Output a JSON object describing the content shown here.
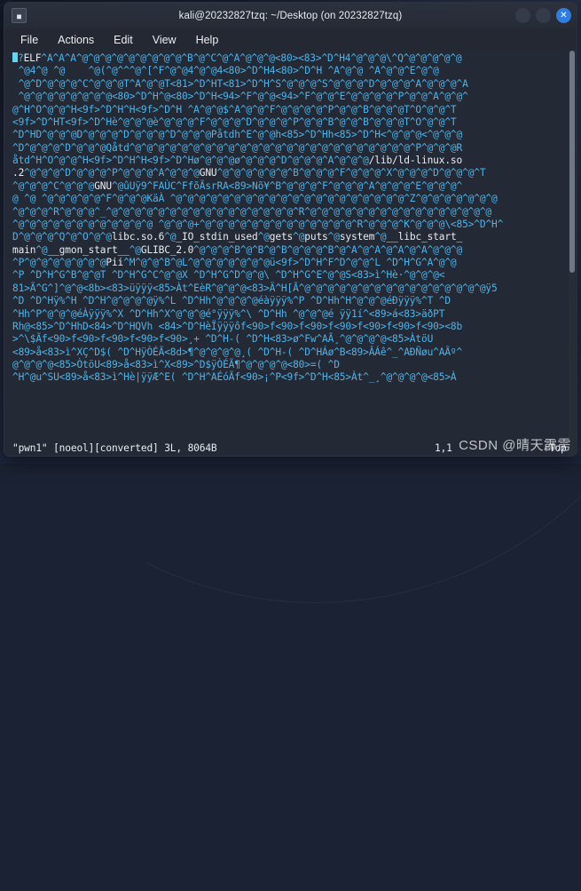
{
  "window": {
    "title": "kali@20232827tzq: ~/Desktop (on 20232827tzq)",
    "app_icon": "terminal-icon",
    "icon_glyph": "■",
    "buttons": {
      "minimize": "",
      "maximize": "",
      "close": "✕"
    }
  },
  "menubar": {
    "items": [
      {
        "label": "File"
      },
      {
        "label": "Actions"
      },
      {
        "label": "Edit"
      },
      {
        "label": "View"
      },
      {
        "label": "Help"
      }
    ]
  },
  "colors": {
    "window_bg": "#232832",
    "titlebar_bg": "#2b313d",
    "terminal_bg": "#242a35",
    "binary_text": "#4fb3e8",
    "ascii_text": "#e9ecf1",
    "close_button": "#2f7de1",
    "cursor": "#5fd7f5"
  },
  "terminal": {
    "cursor_char": "^",
    "lines": [
      "?ELF^A^A^A^@^@^@^@^@^@^@^@^@^B^@^C^@^A^@^@^@<80><83>^D^H4^@^@^@\\^Q^@^@^@^@^@",
      " ^@4^@ ^@    ^@(^@^^^@^[^F^@^@4^@^@4<80>^D^H4<80>^D^H ^A^@^@ ^A^@^@^E^@^@",
      " ^@^D^@^@^@^C^@^@^@T^A^@^@T<81>^D^HT<81>^D^H^S^@^@^@^S^@^@^@^D^@^@^@^A^@^@^@^A",
      " ^@^@^@^@^@^@^@^@<80>^D^H^@<80>^D^H<94>^F^@^@<94>^F^@^@^E^@^@^@^@^P^@^@^A^@^@^",
      "@^H^O^@^@^H<9f>^D^H^H<9f>^D^H ^A^@^@$^A^@^@^F^@^@^@^@^P^@^@^B^@^@^@T^O^@^@^T",
      "<9f>^D^HT<9f>^D^Hè^@^@^@è^@^@^@^F^@^@^@^D^@^@^@^P^@^@^B^@^@^B^@^@^@T^O^@^@^T",
      "^D^HD^@^@^@D^@^@^@^D^@^@^@^D^@^@^@Påtdh^E^@^@h<85>^D^Hh<85>^D^H<^@^@^@<^@^@^@",
      "^D^@^@^@^D^@^@^@Qåtd^@^@^@^@^@^@^@^@^@^@^@^@^@^@^@^@^@^@^@^@^@^@^@^@^P^@^@^@R",
      "åtd^H^O^@^@^H<9f>^D^H^H<9f>^D^Hø^@^@^@ø^@^@^@^D^@^@^@^A^@^@^@/lib/ld-linux.so",
      ".2^@^@^@^D^@^@^@^P^@^@^@^A^@^@^@GNU^@^@^@^@^@^@^B^@^@^@^F^@^@^@^X^@^@^@^D^@^@^@^T",
      "^@^@^@^C^@^@^@GNU^@ûUÿ9^FAÙC^FfõÃsrRA<89>Nõ¥^B^@^@^@^F^@^@^@^A^@^@^@^E^@^@^@^",
      "@ ^@ ^@^@^@^@^@^F^@^@^@KäÀ ^@^@^@^@^@^@^@^@^@^@^@^@^@^@^@^@^@^@^@^@^Z^@^@^@^@^@^@^@",
      "^@^@^@^R^@^@^@^_^@^@^@^@^@^@^@^@^@^@^@^@^@^@^@^@^R^@^@^@^@^@^@^@^@^@^@^@^@^@^@^@^@",
      "^@^@^@^@^@^@^@^@^@^@^@^@ ^@^@^@+^@^@^@^@^@^@^@^@^@^@^@^@^@^R^@^@^@^K^@^@^@\\<85>^D^H^",
      "D^@^@^@^Q^@^O^@^@libc.so.6^@_IO_stdin_used^@gets^@puts^@system^@__libc_start_",
      "main^@__gmon_start__^@GLIBC_2.0^@^@^@^B^@^B^@^B^@^@^@^B^@^A^@^A^@^A^@^A^@^@^@",
      "^P^@^@^@^@^@^@^@Pii^M^@^@^B^@L^@^@^@^@^@^@^@ü<9f>^D^H^F^D^@^@^L ^D^H^G^A^@^@",
      "^P ^D^H^G^B^@^@T ^D^H^G^C^@^@X ^D^H^G^D^@^@\\ ^D^H^G^E^@^@S<83>ì^Hè·^@^@^@<",
      "81>Ã^G^]^@^@<8b><83>üÿÿÿ<85>Àt^EèR^@^@^@<83>Ä^H[Ã^@^@^@^@^@^@^@^@^@^@^@^@^@^@^@^@ÿ5",
      "^D ^D^Hÿ%^H ^D^H^@^@^@^@ÿ%^L ^D^Hh^@^@^@^@éàÿÿÿ%^P ^D^Hh^H^@^@^@éÐÿÿÿ%^T ^D",
      "^Hh^P^@^@^@éÀÿÿÿ%^X ^D^Hh^X^@^@^@é°ÿÿÿ%^\\ ^D^Hh ^@^@^@é ÿÿ1í^<89>á<83>äðPT",
      "Rh@<85>^D^HhD<84>^D^HQVh <84>^D^HèÏÿÿÿôf<90>f<90>f<90>f<90>f<90>f<90>f<90><8b",
      ">^\\$Ãf<90>f<90>f<90>f<90>f<90>¸+ ^D^H-( ^D^H<83>ø^Fw^AÃ¸^@^@^@^@<85>ÀtöU",
      "<89>å<83>ì^XÇ^D$( ^D^HÿÒÉÃ<8d>¶^@^@^@^@¸( ^D^H-( ^D^HÁø^B<89>ÂÁê^_^AÐÑøu^AÃº^",
      "@^@^@^@<85>ÒtöU<89>å<83>ì^X<89>^D$ÿÒÉÃ¶^@^@^@^@<80>=( ^D",
      "^H^@u^SU<89>å<83>ì^Hè|ÿÿÆ^E( ^D^H^AÉóÃf<90>¡^P<9f>^D^H<85>Àt^_¸^@^@^@^@<85>À"
    ]
  },
  "statusline": {
    "file": "\"pwn1\" [noeol][converted] 3L, 8064B",
    "ruler": "1,1",
    "position": "Top"
  },
  "watermark": {
    "text": "CSDN @晴天霹雳"
  }
}
